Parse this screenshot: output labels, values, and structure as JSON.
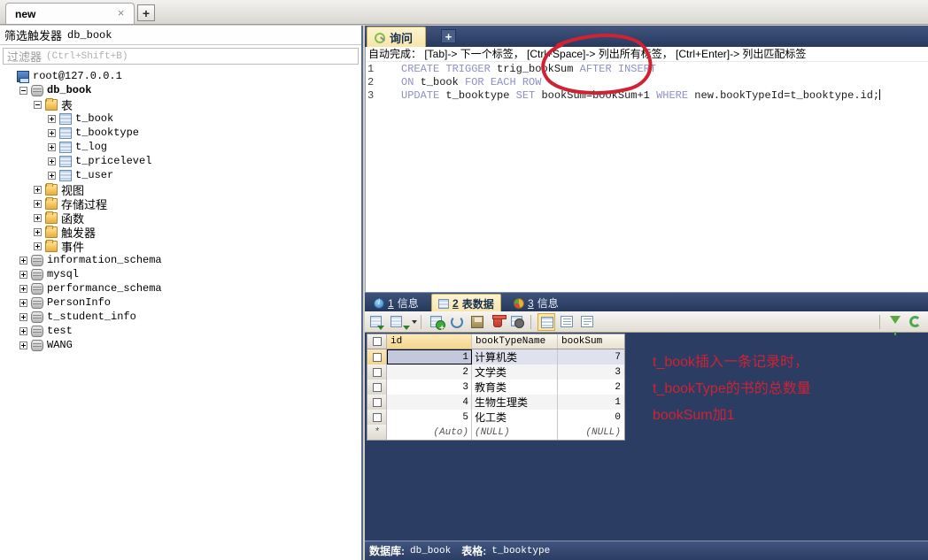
{
  "window": {
    "doc_tab": {
      "label": "new",
      "close": "×"
    },
    "new_tab_button": "+"
  },
  "sidebar": {
    "title_zh": "筛选触发器",
    "title_db": "db_book",
    "filter_placeholder_zh": "过滤器",
    "filter_placeholder_key": "(Ctrl+Shift+B)",
    "tree": [
      {
        "label": "root@127.0.0.1",
        "icon": "server-icon",
        "indent": 0,
        "expander": "none",
        "bold": false,
        "zh": false
      },
      {
        "label": "db_book",
        "icon": "database-icon",
        "indent": 1,
        "expander": "minus",
        "bold": true,
        "zh": false
      },
      {
        "label": "表",
        "icon": "folder-icon",
        "indent": 2,
        "expander": "minus",
        "bold": false,
        "zh": true
      },
      {
        "label": "t_book",
        "icon": "table-icon",
        "indent": 3,
        "expander": "plus",
        "bold": false,
        "zh": false
      },
      {
        "label": "t_booktype",
        "icon": "table-icon",
        "indent": 3,
        "expander": "plus",
        "bold": false,
        "zh": false
      },
      {
        "label": "t_log",
        "icon": "table-icon",
        "indent": 3,
        "expander": "plus",
        "bold": false,
        "zh": false
      },
      {
        "label": "t_pricelevel",
        "icon": "table-icon",
        "indent": 3,
        "expander": "plus",
        "bold": false,
        "zh": false
      },
      {
        "label": "t_user",
        "icon": "table-icon",
        "indent": 3,
        "expander": "plus",
        "bold": false,
        "zh": false
      },
      {
        "label": "视图",
        "icon": "folder-icon",
        "indent": 2,
        "expander": "plus",
        "bold": false,
        "zh": true
      },
      {
        "label": "存储过程",
        "icon": "folder-icon",
        "indent": 2,
        "expander": "plus",
        "bold": false,
        "zh": true
      },
      {
        "label": "函数",
        "icon": "folder-icon",
        "indent": 2,
        "expander": "plus",
        "bold": false,
        "zh": true
      },
      {
        "label": "触发器",
        "icon": "folder-icon",
        "indent": 2,
        "expander": "plus",
        "bold": false,
        "zh": true
      },
      {
        "label": "事件",
        "icon": "folder-icon",
        "indent": 2,
        "expander": "plus",
        "bold": false,
        "zh": true
      },
      {
        "label": "information_schema",
        "icon": "database-icon",
        "indent": 1,
        "expander": "plus",
        "bold": false,
        "zh": false
      },
      {
        "label": "mysql",
        "icon": "database-icon",
        "indent": 1,
        "expander": "plus",
        "bold": false,
        "zh": false
      },
      {
        "label": "performance_schema",
        "icon": "database-icon",
        "indent": 1,
        "expander": "plus",
        "bold": false,
        "zh": false
      },
      {
        "label": "PersonInfo",
        "icon": "database-icon",
        "indent": 1,
        "expander": "plus",
        "bold": false,
        "zh": false
      },
      {
        "label": "t_student_info",
        "icon": "database-icon",
        "indent": 1,
        "expander": "plus",
        "bold": false,
        "zh": false
      },
      {
        "label": "test",
        "icon": "database-icon",
        "indent": 1,
        "expander": "plus",
        "bold": false,
        "zh": false
      },
      {
        "label": "WANG",
        "icon": "database-icon",
        "indent": 1,
        "expander": "plus",
        "bold": false,
        "zh": false
      }
    ]
  },
  "query": {
    "tab_label": "询问",
    "add_tab": "+",
    "hint": "自动完成： [Tab]-> 下一个标签， [Ctrl+Space]-> 列出所有标签， [Ctrl+Enter]-> 列出匹配标签",
    "lines": [
      {
        "no": "1",
        "tokens": [
          {
            "t": "CREATE TRIGGER ",
            "k": true
          },
          {
            "t": "trig_bookSum ",
            "k": false
          },
          {
            "t": "AFTER INSERT",
            "k": true
          }
        ]
      },
      {
        "no": "2",
        "tokens": [
          {
            "t": "ON ",
            "k": true
          },
          {
            "t": "t_book ",
            "k": false
          },
          {
            "t": "FOR EACH ROW",
            "k": true
          }
        ]
      },
      {
        "no": "3",
        "tokens": [
          {
            "t": "UPDATE ",
            "k": true
          },
          {
            "t": "t_booktype ",
            "k": false
          },
          {
            "t": "SET ",
            "k": true
          },
          {
            "t": "bookSum=bookSum+1 ",
            "k": false
          },
          {
            "t": "WHERE ",
            "k": true
          },
          {
            "t": "new.bookTypeId=t_booktype.id;",
            "k": false
          }
        ]
      }
    ]
  },
  "results": {
    "tabs": [
      {
        "num": "1",
        "label": "信息",
        "icon": "info-circle-icon",
        "active": false
      },
      {
        "num": "2",
        "label": "表数据",
        "icon": "grid-icon",
        "active": true
      },
      {
        "num": "3",
        "label": "信息",
        "icon": "pie-chart-icon",
        "active": false
      }
    ],
    "toolbar": [
      {
        "name": "grid-insert-icon"
      },
      {
        "name": "grid-insert-dropdown-icon"
      },
      {
        "name": "add-record-icon"
      },
      {
        "name": "refresh-icon"
      },
      {
        "name": "save-record-icon"
      },
      {
        "name": "delete-record-icon"
      },
      {
        "name": "cancel-edit-icon"
      },
      {
        "name": "grid-view-icon"
      },
      {
        "name": "form-view-icon"
      },
      {
        "name": "text-view-icon"
      },
      {
        "name": "filter-icon"
      },
      {
        "name": "sync-icon"
      }
    ]
  },
  "table": {
    "columns": [
      "id",
      "bookTypeName",
      "bookSum"
    ],
    "rows": [
      {
        "id": "1",
        "bookTypeName": "计算机类",
        "bookSum": "7",
        "selected": true
      },
      {
        "id": "2",
        "bookTypeName": "文学类",
        "bookSum": "3",
        "selected": false
      },
      {
        "id": "3",
        "bookTypeName": "教育类",
        "bookSum": "2",
        "selected": false
      },
      {
        "id": "4",
        "bookTypeName": "生物生理类",
        "bookSum": "1",
        "selected": false
      },
      {
        "id": "5",
        "bookTypeName": "化工类",
        "bookSum": "0",
        "selected": false
      }
    ],
    "new_row": {
      "marker": "*",
      "id": "(Auto)",
      "bookTypeName": "(NULL)",
      "bookSum": "(NULL)"
    }
  },
  "annotation": {
    "color": "#cf2233",
    "line1": "t_book插入一条记录时，",
    "line2": "t_bookType的书的总数量",
    "line3": "bookSum加1"
  },
  "status": {
    "db_label": "数据库:",
    "db_value": "db_book",
    "table_label": "表格:",
    "table_value": "t_booktype"
  }
}
